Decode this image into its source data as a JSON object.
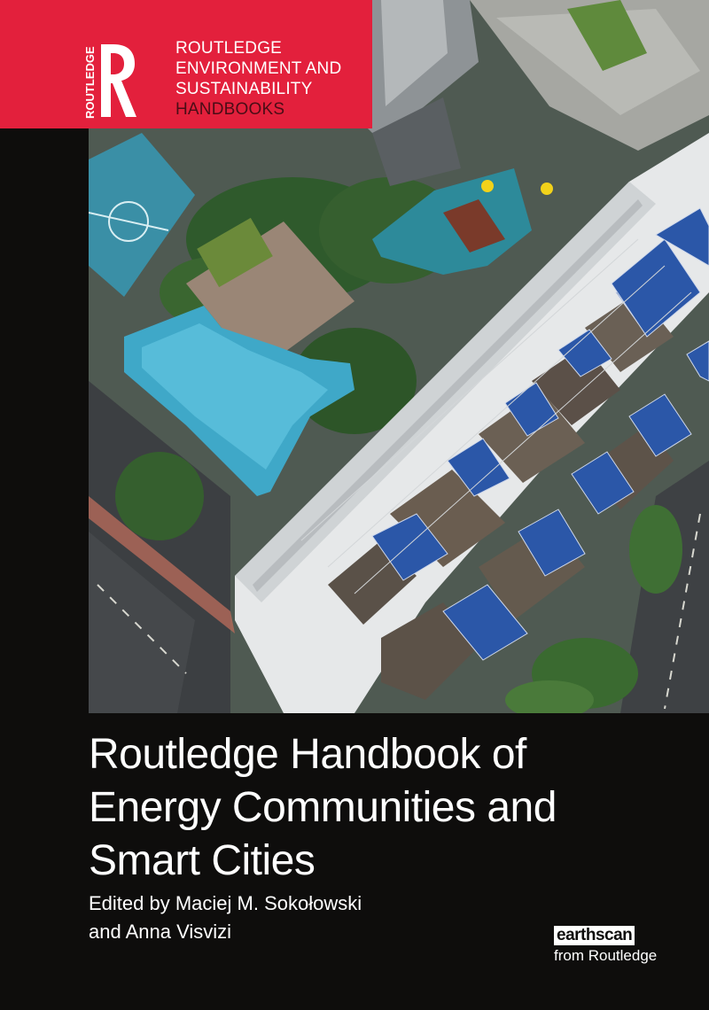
{
  "series": {
    "publisher_mark": "ROUTLEDGE",
    "lines": [
      "ROUTLEDGE",
      "ENVIRONMENT AND",
      "SUSTAINABILITY",
      "HANDBOOKS"
    ],
    "color": "#e3203c"
  },
  "title": {
    "lines": [
      "Routledge Handbook of",
      "Energy Communities and",
      "Smart Cities"
    ]
  },
  "editors": {
    "lines": [
      "Edited by Maciej M. Sokołowski",
      "and Anna Visvizi"
    ]
  },
  "imprint": {
    "mark": "earthscan",
    "sub": "from Routledge"
  },
  "icons": {
    "publisher_logo": "routledge-r-profile-icon"
  }
}
